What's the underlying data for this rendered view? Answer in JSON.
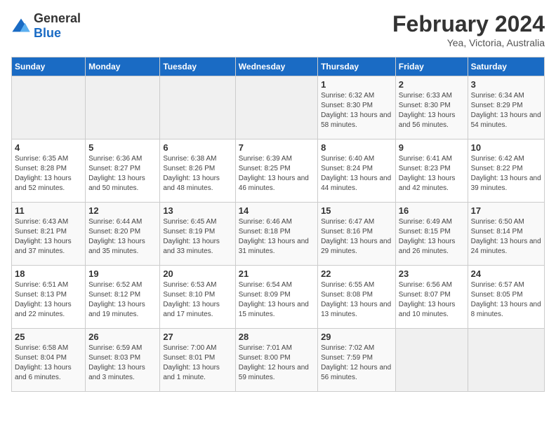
{
  "header": {
    "logo_general": "General",
    "logo_blue": "Blue",
    "title": "February 2024",
    "subtitle": "Yea, Victoria, Australia"
  },
  "calendar": {
    "days_of_week": [
      "Sunday",
      "Monday",
      "Tuesday",
      "Wednesday",
      "Thursday",
      "Friday",
      "Saturday"
    ],
    "weeks": [
      [
        {
          "day": "",
          "empty": true
        },
        {
          "day": "",
          "empty": true
        },
        {
          "day": "",
          "empty": true
        },
        {
          "day": "",
          "empty": true
        },
        {
          "day": "1",
          "sunrise": "6:32 AM",
          "sunset": "8:30 PM",
          "daylight": "13 hours and 58 minutes."
        },
        {
          "day": "2",
          "sunrise": "6:33 AM",
          "sunset": "8:30 PM",
          "daylight": "13 hours and 56 minutes."
        },
        {
          "day": "3",
          "sunrise": "6:34 AM",
          "sunset": "8:29 PM",
          "daylight": "13 hours and 54 minutes."
        }
      ],
      [
        {
          "day": "4",
          "sunrise": "6:35 AM",
          "sunset": "8:28 PM",
          "daylight": "13 hours and 52 minutes."
        },
        {
          "day": "5",
          "sunrise": "6:36 AM",
          "sunset": "8:27 PM",
          "daylight": "13 hours and 50 minutes."
        },
        {
          "day": "6",
          "sunrise": "6:38 AM",
          "sunset": "8:26 PM",
          "daylight": "13 hours and 48 minutes."
        },
        {
          "day": "7",
          "sunrise": "6:39 AM",
          "sunset": "8:25 PM",
          "daylight": "13 hours and 46 minutes."
        },
        {
          "day": "8",
          "sunrise": "6:40 AM",
          "sunset": "8:24 PM",
          "daylight": "13 hours and 44 minutes."
        },
        {
          "day": "9",
          "sunrise": "6:41 AM",
          "sunset": "8:23 PM",
          "daylight": "13 hours and 42 minutes."
        },
        {
          "day": "10",
          "sunrise": "6:42 AM",
          "sunset": "8:22 PM",
          "daylight": "13 hours and 39 minutes."
        }
      ],
      [
        {
          "day": "11",
          "sunrise": "6:43 AM",
          "sunset": "8:21 PM",
          "daylight": "13 hours and 37 minutes."
        },
        {
          "day": "12",
          "sunrise": "6:44 AM",
          "sunset": "8:20 PM",
          "daylight": "13 hours and 35 minutes."
        },
        {
          "day": "13",
          "sunrise": "6:45 AM",
          "sunset": "8:19 PM",
          "daylight": "13 hours and 33 minutes."
        },
        {
          "day": "14",
          "sunrise": "6:46 AM",
          "sunset": "8:18 PM",
          "daylight": "13 hours and 31 minutes."
        },
        {
          "day": "15",
          "sunrise": "6:47 AM",
          "sunset": "8:16 PM",
          "daylight": "13 hours and 29 minutes."
        },
        {
          "day": "16",
          "sunrise": "6:49 AM",
          "sunset": "8:15 PM",
          "daylight": "13 hours and 26 minutes."
        },
        {
          "day": "17",
          "sunrise": "6:50 AM",
          "sunset": "8:14 PM",
          "daylight": "13 hours and 24 minutes."
        }
      ],
      [
        {
          "day": "18",
          "sunrise": "6:51 AM",
          "sunset": "8:13 PM",
          "daylight": "13 hours and 22 minutes."
        },
        {
          "day": "19",
          "sunrise": "6:52 AM",
          "sunset": "8:12 PM",
          "daylight": "13 hours and 19 minutes."
        },
        {
          "day": "20",
          "sunrise": "6:53 AM",
          "sunset": "8:10 PM",
          "daylight": "13 hours and 17 minutes."
        },
        {
          "day": "21",
          "sunrise": "6:54 AM",
          "sunset": "8:09 PM",
          "daylight": "13 hours and 15 minutes."
        },
        {
          "day": "22",
          "sunrise": "6:55 AM",
          "sunset": "8:08 PM",
          "daylight": "13 hours and 13 minutes."
        },
        {
          "day": "23",
          "sunrise": "6:56 AM",
          "sunset": "8:07 PM",
          "daylight": "13 hours and 10 minutes."
        },
        {
          "day": "24",
          "sunrise": "6:57 AM",
          "sunset": "8:05 PM",
          "daylight": "13 hours and 8 minutes."
        }
      ],
      [
        {
          "day": "25",
          "sunrise": "6:58 AM",
          "sunset": "8:04 PM",
          "daylight": "13 hours and 6 minutes."
        },
        {
          "day": "26",
          "sunrise": "6:59 AM",
          "sunset": "8:03 PM",
          "daylight": "13 hours and 3 minutes."
        },
        {
          "day": "27",
          "sunrise": "7:00 AM",
          "sunset": "8:01 PM",
          "daylight": "13 hours and 1 minute."
        },
        {
          "day": "28",
          "sunrise": "7:01 AM",
          "sunset": "8:00 PM",
          "daylight": "12 hours and 59 minutes."
        },
        {
          "day": "29",
          "sunrise": "7:02 AM",
          "sunset": "7:59 PM",
          "daylight": "12 hours and 56 minutes."
        },
        {
          "day": "",
          "empty": true
        },
        {
          "day": "",
          "empty": true
        }
      ]
    ],
    "labels": {
      "sunrise": "Sunrise:",
      "sunset": "Sunset:",
      "daylight": "Daylight:"
    }
  }
}
